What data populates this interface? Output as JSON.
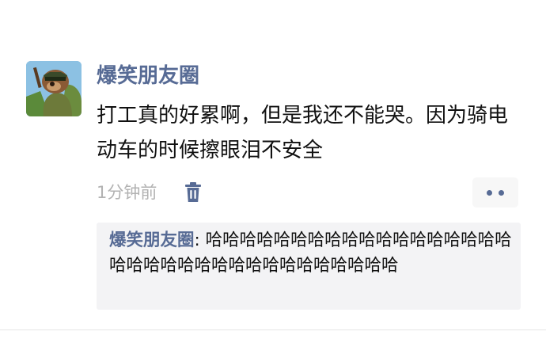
{
  "post": {
    "author": "爆笑朋友圈",
    "text": "打工真的好累啊，但是我还不能哭。因为骑电动车的时候擦眼泪不安全",
    "time": "1分钟前"
  },
  "icons": {
    "avatar": "cartoon-bear-avatar",
    "delete": "trash-icon",
    "more": "more-dots-icon"
  },
  "comments": [
    {
      "author": "爆笑朋友圈",
      "separator": ": ",
      "text": "哈哈哈哈哈哈哈哈哈哈哈哈哈哈哈哈哈哈哈哈哈哈哈哈哈哈哈哈哈哈哈哈哈哈哈"
    }
  ],
  "colors": {
    "link": "#576b95",
    "text": "#111111",
    "muted": "#b2b2b2",
    "comment_bg": "#f3f3f5"
  }
}
